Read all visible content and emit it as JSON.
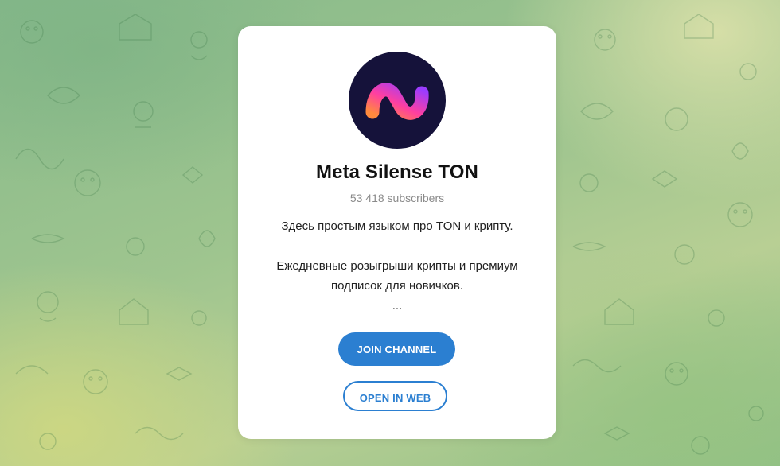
{
  "channel": {
    "name": "Meta Silense TON",
    "subscribers": "53 418 subscribers",
    "description_line1": "Здесь простым языком про TON и крипту.",
    "description_line2": "Ежедневные розыгрыши крипты и премиум",
    "description_line3": "подписок для новичков.",
    "description_more": "..."
  },
  "buttons": {
    "join_label": "JOIN CHANNEL",
    "open_web_label": "OPEN IN WEB"
  },
  "colors": {
    "accent": "#2b7fd1",
    "avatar_background": "#15123a"
  },
  "icons": {
    "avatar_logo": "gradient-wave-n-logo"
  }
}
